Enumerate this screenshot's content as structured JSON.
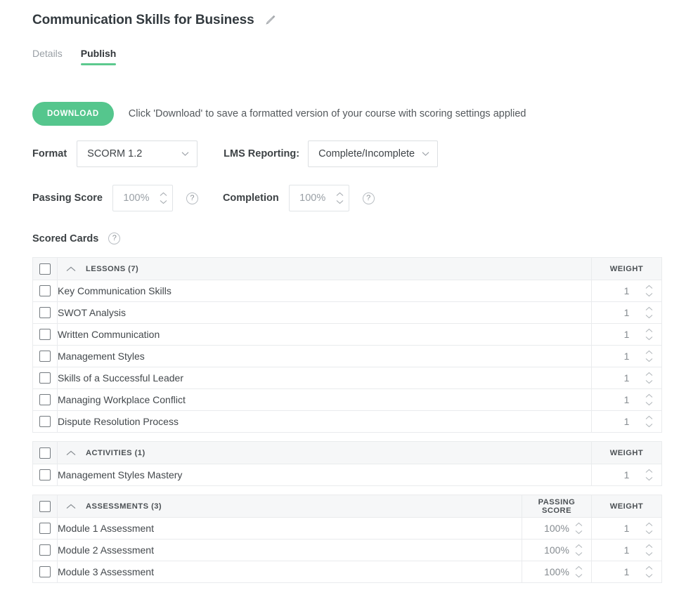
{
  "header": {
    "course_title": "Communication Skills for Business",
    "edit_icon": "pencil-icon"
  },
  "tabs": [
    {
      "label": "Details",
      "active": false
    },
    {
      "label": "Publish",
      "active": true
    }
  ],
  "publish": {
    "download_label": "DOWNLOAD",
    "download_hint": "Click 'Download' to save a formatted version of your course with scoring settings applied",
    "format_label": "Format",
    "format_value": "SCORM 1.2",
    "lms_label": "LMS Reporting:",
    "lms_value": "Complete/Incomplete",
    "passing_score_label": "Passing Score",
    "passing_score_value": "100%",
    "completion_label": "Completion",
    "completion_value": "100%",
    "help_glyph": "?",
    "scored_cards_label": "Scored Cards"
  },
  "columns": {
    "passing_score": "PASSING SCORE",
    "weight": "WEIGHT"
  },
  "sections": [
    {
      "title": "LESSONS",
      "count": "(7)",
      "has_passing_score": false,
      "rows": [
        {
          "name": "Key Communication Skills",
          "weight": "1"
        },
        {
          "name": "SWOT Analysis",
          "weight": "1"
        },
        {
          "name": "Written Communication",
          "weight": "1"
        },
        {
          "name": "Management Styles",
          "weight": "1"
        },
        {
          "name": "Skills of a Successful Leader",
          "weight": "1"
        },
        {
          "name": "Managing Workplace Conflict",
          "weight": "1"
        },
        {
          "name": "Dispute Resolution Process",
          "weight": "1"
        }
      ]
    },
    {
      "title": "ACTIVITIES",
      "count": "(1)",
      "has_passing_score": false,
      "rows": [
        {
          "name": "Management Styles Mastery",
          "weight": "1"
        }
      ]
    },
    {
      "title": "ASSESSMENTS",
      "count": "(3)",
      "has_passing_score": true,
      "rows": [
        {
          "name": "Module 1 Assessment",
          "passing_score": "100%",
          "weight": "1"
        },
        {
          "name": "Module 2 Assessment",
          "passing_score": "100%",
          "weight": "1"
        },
        {
          "name": "Module 3 Assessment",
          "passing_score": "100%",
          "weight": "1"
        }
      ]
    }
  ],
  "colors": {
    "accent_green": "#55c68d",
    "tab_underline": "#5cc98e",
    "header_bg": "#f6f7f8",
    "border": "#e3e6e8"
  }
}
